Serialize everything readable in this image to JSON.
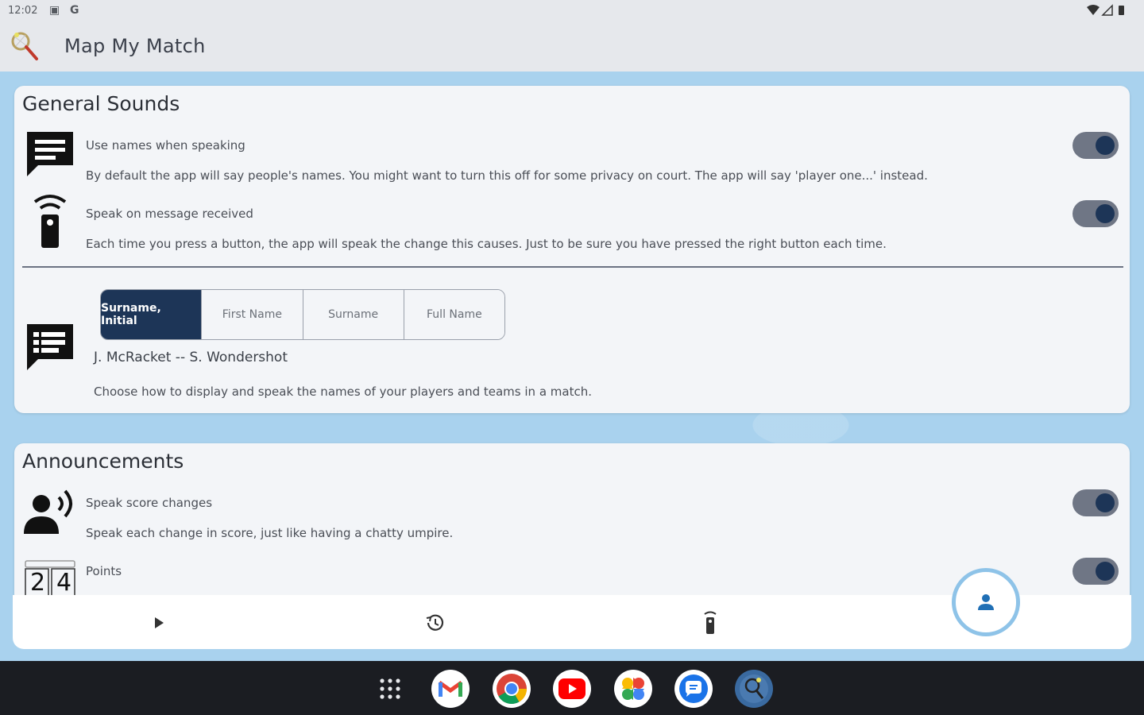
{
  "status_bar": {
    "time": "12:02"
  },
  "app": {
    "title": "Map My Match"
  },
  "general_sounds": {
    "title": "General Sounds",
    "settings": [
      {
        "title": "Use names when speaking",
        "description": "By default the app will say people's names. You might want to turn this off for some privacy on court. The app will say 'player one...' instead.",
        "enabled": true
      },
      {
        "title": "Speak on message received",
        "description": "Each time you press a button, the app will speak the change this causes. Just to be sure you have pressed the right button each time.",
        "enabled": true
      }
    ],
    "name_format": {
      "options": [
        "Surname, Initial",
        "First Name",
        "Surname",
        "Full Name"
      ],
      "selected": "Surname, Initial",
      "example": "J. McRacket -- S. Wondershot",
      "description": "Choose how to display and speak the names of your players and teams in a match."
    }
  },
  "announcements": {
    "title": "Announcements",
    "settings": [
      {
        "title": "Speak score changes",
        "description": "Speak each change in score, just like having a chatty umpire.",
        "enabled": true
      },
      {
        "title": "Points",
        "enabled": true,
        "icon_digits": [
          "2",
          "4"
        ]
      }
    ]
  },
  "bottom_nav": {
    "items": [
      "play-icon",
      "history-icon",
      "remote-icon",
      "person-icon"
    ]
  },
  "taskbar": {
    "apps": [
      "app-launcher",
      "gmail",
      "chrome",
      "youtube",
      "photos",
      "messages",
      "map-my-match"
    ]
  },
  "colors": {
    "accent": "#1d3557",
    "toggle_track": "#6f7685",
    "background": "#a9d2ee",
    "card": "#f3f5f8"
  }
}
